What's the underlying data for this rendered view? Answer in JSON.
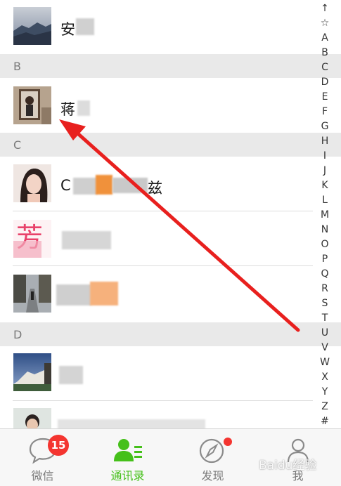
{
  "contacts": {
    "top_row": {
      "name": "安"
    },
    "sections": [
      {
        "letter": "B",
        "items": [
          {
            "name": "蒋"
          }
        ]
      },
      {
        "letter": "C",
        "items": [
          {
            "name": "C"
          },
          {
            "name": ""
          },
          {
            "name": ""
          }
        ]
      },
      {
        "letter": "D",
        "items": [
          {
            "name": ""
          },
          {
            "name": ""
          }
        ]
      }
    ],
    "c_row_suffix": "兹"
  },
  "index_bar": [
    "↑",
    "☆",
    "A",
    "B",
    "C",
    "D",
    "E",
    "F",
    "G",
    "H",
    "I",
    "J",
    "K",
    "L",
    "M",
    "N",
    "O",
    "P",
    "Q",
    "R",
    "S",
    "T",
    "U",
    "V",
    "W",
    "X",
    "Y",
    "Z",
    "#"
  ],
  "tabbar": {
    "tabs": [
      {
        "label": "微信",
        "icon": "chat-bubble-icon",
        "badge": "15"
      },
      {
        "label": "通讯录",
        "icon": "contacts-icon",
        "active": true
      },
      {
        "label": "发现",
        "icon": "compass-icon",
        "dot": true
      },
      {
        "label": "我",
        "icon": "person-icon"
      }
    ]
  },
  "watermark": "Baidu经验",
  "colors": {
    "active": "#45c01a",
    "badge": "#f43530",
    "arrow": "#e8201e"
  }
}
